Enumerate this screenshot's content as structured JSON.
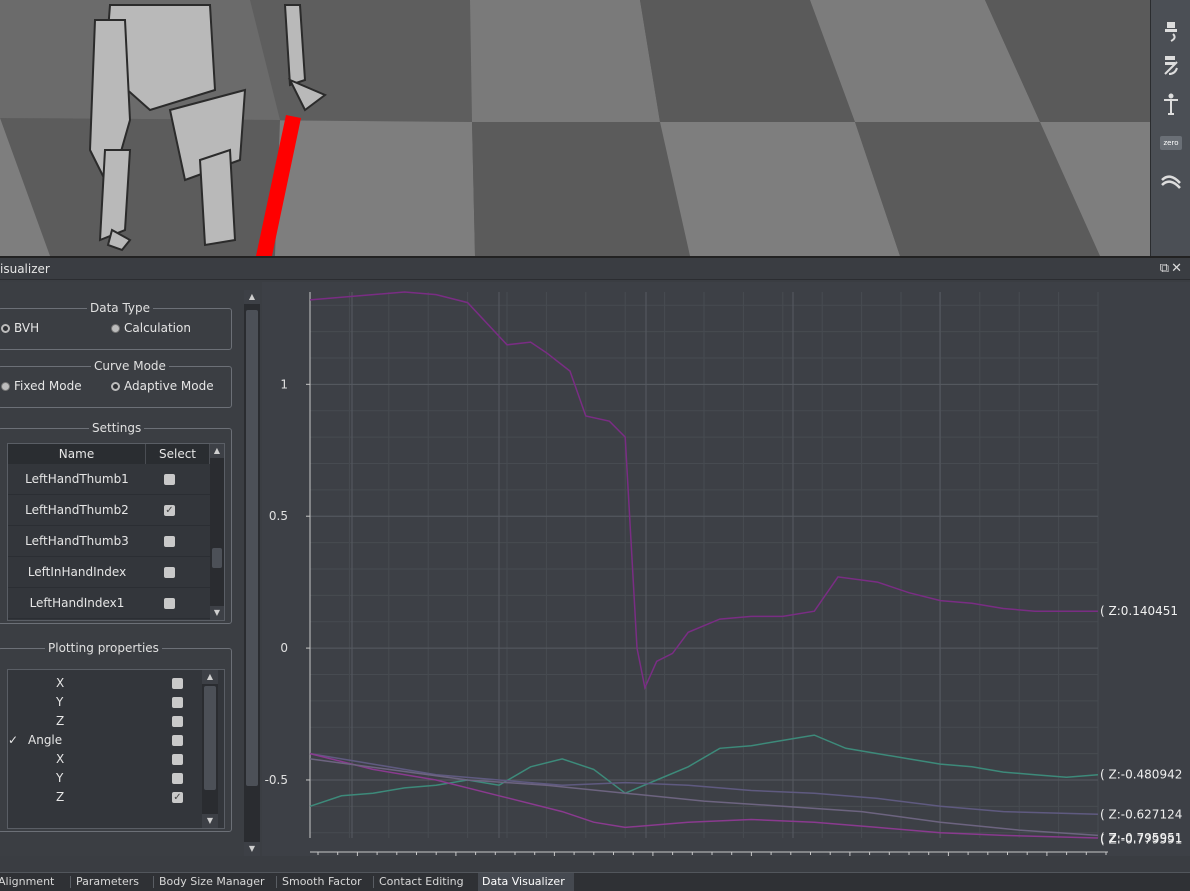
{
  "window": {
    "title": "isualizer"
  },
  "toolbar": {
    "icons": [
      "brush-down-icon",
      "brush-erase-icon",
      "skeleton-pose-icon",
      "zero-icon",
      "flow-icon"
    ],
    "zero_label": "zero"
  },
  "left_panel": {
    "data_type": {
      "title": "Data Type",
      "options": [
        {
          "label": "BVH",
          "selected": false
        },
        {
          "label": "Calculation",
          "selected": true
        }
      ]
    },
    "curve_mode": {
      "title": "Curve Mode",
      "options": [
        {
          "label": "Fixed Mode",
          "selected": true
        },
        {
          "label": "Adaptive Mode",
          "selected": false
        }
      ]
    },
    "settings": {
      "title": "Settings",
      "columns": [
        "Name",
        "Select"
      ],
      "rows": [
        {
          "name": "LeftHandThumb1",
          "checked": false
        },
        {
          "name": "LeftHandThumb2",
          "checked": true
        },
        {
          "name": "LeftHandThumb3",
          "checked": false
        },
        {
          "name": "LeftInHandIndex",
          "checked": false
        },
        {
          "name": "LeftHandIndex1",
          "checked": false
        }
      ]
    },
    "plotting": {
      "title": "Plotting properties",
      "rows": [
        {
          "label": "X",
          "checked": false
        },
        {
          "label": "Y",
          "checked": false
        },
        {
          "label": "Z",
          "checked": false
        },
        {
          "label": "Angle",
          "checked": false,
          "expanded": true
        },
        {
          "label": "X",
          "checked": false
        },
        {
          "label": "Y",
          "checked": false
        },
        {
          "label": "Z",
          "checked": true
        }
      ]
    }
  },
  "chart_data": {
    "type": "line",
    "ylim": [
      -0.72,
      1.35
    ],
    "yticks": [
      "1",
      "0.5",
      "0",
      "-0.5"
    ],
    "grid": true,
    "x_range": [
      0,
      100
    ],
    "series": [
      {
        "name": "Z:0.140451",
        "color": "#7a2d84",
        "x": [
          0,
          4,
          8,
          12,
          16,
          20,
          25,
          28,
          30,
          33,
          35,
          38,
          40,
          41.5,
          42.5,
          44,
          46,
          48,
          52,
          56,
          60,
          64,
          67,
          72,
          76,
          80,
          84,
          88,
          92,
          96,
          100
        ],
        "y": [
          1.32,
          1.33,
          1.34,
          1.35,
          1.34,
          1.31,
          1.15,
          1.16,
          1.12,
          1.05,
          0.88,
          0.86,
          0.8,
          0.0,
          -0.15,
          -0.05,
          -0.02,
          0.06,
          0.11,
          0.12,
          0.12,
          0.14,
          0.27,
          0.25,
          0.21,
          0.18,
          0.17,
          0.15,
          0.14,
          0.14,
          0.14
        ]
      },
      {
        "name": "Z:-0.480942",
        "color": "#3d8a7a",
        "x": [
          0,
          4,
          8,
          12,
          16,
          20,
          24,
          28,
          32,
          36,
          40,
          44,
          48,
          52,
          56,
          60,
          64,
          68,
          72,
          76,
          80,
          84,
          88,
          92,
          96,
          100
        ],
        "y": [
          -0.6,
          -0.56,
          -0.55,
          -0.53,
          -0.52,
          -0.5,
          -0.52,
          -0.45,
          -0.42,
          -0.46,
          -0.55,
          -0.5,
          -0.45,
          -0.38,
          -0.37,
          -0.35,
          -0.33,
          -0.38,
          -0.4,
          -0.42,
          -0.44,
          -0.45,
          -0.47,
          -0.48,
          -0.49,
          -0.48
        ]
      },
      {
        "name": "Z:-0.627124",
        "color": "#5f5a80",
        "x": [
          0,
          8,
          16,
          24,
          32,
          40,
          48,
          56,
          64,
          72,
          80,
          88,
          100
        ],
        "y": [
          -0.4,
          -0.44,
          -0.48,
          -0.5,
          -0.52,
          -0.51,
          -0.52,
          -0.54,
          -0.55,
          -0.57,
          -0.6,
          -0.62,
          -0.63
        ]
      },
      {
        "name": "Z:-0.795951",
        "color": "#8a3a8f",
        "x": [
          0,
          8,
          16,
          24,
          32,
          36,
          40,
          48,
          56,
          64,
          72,
          80,
          88,
          100
        ],
        "y": [
          -0.4,
          -0.46,
          -0.5,
          -0.56,
          -0.62,
          -0.66,
          -0.68,
          -0.66,
          -0.65,
          -0.66,
          -0.68,
          -0.7,
          -0.71,
          -0.72
        ]
      },
      {
        "name": "Z:-0.779591",
        "color": "#6d6480",
        "x": [
          0,
          10,
          20,
          30,
          40,
          50,
          60,
          70,
          80,
          90,
          100
        ],
        "y": [
          -0.42,
          -0.46,
          -0.5,
          -0.52,
          -0.55,
          -0.58,
          -0.6,
          -0.62,
          -0.66,
          -0.69,
          -0.71
        ]
      }
    ],
    "labels": [
      "( Z:0.140451",
      "( Z:-0.480942",
      "( Z:-0.627124",
      "( Z:-0.795951",
      "( Z:-0.779591"
    ]
  },
  "bottom_tabs": [
    "Alignment",
    "Parameters",
    "Body Size Manager",
    "Smooth Factor",
    "Contact Editing",
    "Data Visualizer"
  ],
  "active_tab": "Data Visualizer"
}
